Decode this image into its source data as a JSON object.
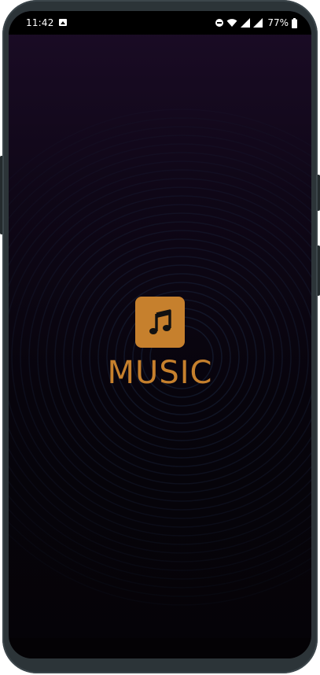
{
  "status_bar": {
    "time": "11:42",
    "battery_text": "77%",
    "icons": [
      "image-icon",
      "dnd-icon",
      "wifi-icon",
      "signal-icon",
      "signal-icon",
      "battery-icon"
    ]
  },
  "splash": {
    "app_name": "MUSIC",
    "logo_icon": "music-note-icon"
  },
  "colors": {
    "accent": "#c6802d",
    "background_top": "#1b0c26",
    "background_bottom": "#050307",
    "ring": "#1c2a44",
    "frame": "#2c3438"
  }
}
